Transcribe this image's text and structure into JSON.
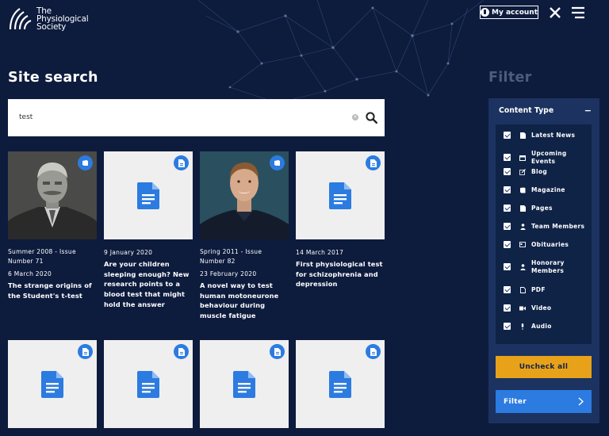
{
  "header": {
    "logo_line1": "The",
    "logo_line2": "Physiological",
    "logo_line3": "Society",
    "account_label": "My account"
  },
  "page_title": "Site search",
  "search": {
    "value": "test",
    "placeholder": ""
  },
  "results_row1": [
    {
      "meta": "Summer 2008 - Issue Number 71",
      "date": "6 March 2020",
      "title": "The strange origins of the Student's t-test"
    },
    {
      "meta": "",
      "date": "9 January 2020",
      "title": "Are your children sleeping enough? New research points to a blood test that might hold the answer"
    },
    {
      "meta": "Spring 2011 - Issue Number 82",
      "date": "23 February 2020",
      "title": "A novel way to test human motoneurone behaviour during muscle fatigue"
    },
    {
      "meta": "",
      "date": "14 March 2017",
      "title": "First physiological test for schizophrenia and depression"
    }
  ],
  "filter": {
    "title": "Filter",
    "content_type_label": "Content Type",
    "collapse_symbol": "−",
    "options": [
      {
        "label": "Latest News",
        "icon": "news-icon",
        "checked": true
      },
      {
        "label": "Upcoming Events",
        "icon": "calendar-icon",
        "checked": true
      },
      {
        "label": "Blog",
        "icon": "pencil-icon",
        "checked": true
      },
      {
        "label": "Magazine",
        "icon": "book-icon",
        "checked": true
      },
      {
        "label": "Pages",
        "icon": "page-icon",
        "checked": true
      },
      {
        "label": "Team Members",
        "icon": "person-icon",
        "checked": true
      },
      {
        "label": "Obituaries",
        "icon": "card-icon",
        "checked": true
      },
      {
        "label": "Honorary Members",
        "icon": "person-icon",
        "checked": true
      },
      {
        "label": "PDF",
        "icon": "pdf-icon",
        "checked": true
      },
      {
        "label": "Video",
        "icon": "video-icon",
        "checked": true
      },
      {
        "label": "Audio",
        "icon": "microphone-icon",
        "checked": true
      }
    ],
    "uncheck_label": "Uncheck all",
    "filter_label": "Filter"
  },
  "colors": {
    "background": "#0d1b3d",
    "panel": "#1c3260",
    "accent_blue": "#2c7be0",
    "accent_orange": "#e8a21a"
  }
}
